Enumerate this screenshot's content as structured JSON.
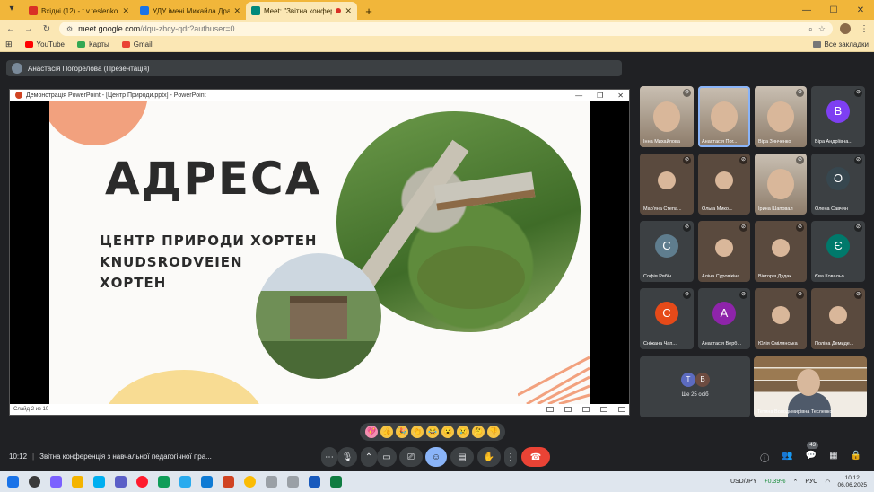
{
  "browser": {
    "tabs": [
      {
        "title": "Вхідні (12) - t.v.teslenko@npu.edu.ua",
        "favicon_color": "#d93025",
        "active": false
      },
      {
        "title": "УДУ імені Михайла Драгоманова",
        "favicon_color": "#1a73e8",
        "active": false
      },
      {
        "title": "Meet: \"Звітна конференція",
        "favicon_color": "#00897b",
        "active": true,
        "recording": true
      }
    ],
    "url_host": "meet.google.com",
    "url_path": "/dqu-zhcy-qdr?authuser=0",
    "bookmarks": [
      {
        "label": "YouTube",
        "color": "#ff0000"
      },
      {
        "label": "Карты",
        "color": "#34a853"
      },
      {
        "label": "Gmail",
        "color": "#ea4335"
      }
    ],
    "all_bookmarks": "Все закладки"
  },
  "meet": {
    "presenter_label": "Анастасія Погорелова (Презентація)",
    "ppt": {
      "window_title": "Демонстрація PowerPoint - [Центр Природи.pptx] - PowerPoint",
      "slide_heading": "АДРЕСА",
      "slide_lines": [
        "ЦЕНТР ПРИРОДИ ХОРТЕН",
        "KNUDSRODVEIEN",
        "ХОРТЕН"
      ],
      "status": "Слайд 2 из 10"
    },
    "participants": [
      {
        "name": "Інна Михайлова",
        "type": "video",
        "mic_muted": true
      },
      {
        "name": "Анастасія Пог...",
        "type": "video",
        "speaking": true
      },
      {
        "name": "Віра Зинченко",
        "type": "video",
        "mic_muted": true
      },
      {
        "name": "Віра Андріївна...",
        "type": "letter",
        "letter": "В",
        "color": "#7e3ff2",
        "mic_muted": true
      },
      {
        "name": "Мар'яна Степа...",
        "type": "photo",
        "mic_muted": true
      },
      {
        "name": "Ольга Мико...",
        "type": "photo",
        "mic_muted": true
      },
      {
        "name": "Ірина Шаповал",
        "type": "video",
        "mic_muted": true
      },
      {
        "name": "Олена Савчин",
        "type": "letter",
        "letter": "О",
        "color": "#37474f",
        "mic_muted": true
      },
      {
        "name": "Софія Рябіч",
        "type": "letter",
        "letter": "С",
        "color": "#5f7d8e",
        "mic_muted": true
      },
      {
        "name": "Аліна Суровікіна",
        "type": "photo",
        "mic_muted": true
      },
      {
        "name": "Вікторія Дудак",
        "type": "photo",
        "mic_muted": true
      },
      {
        "name": "Єва Ковальо...",
        "type": "letter",
        "letter": "Є",
        "color": "#00796b",
        "mic_muted": true
      },
      {
        "name": "Сніжана Чап...",
        "type": "letter",
        "letter": "С",
        "color": "#e64a19",
        "mic_muted": true
      },
      {
        "name": "Анастасія Верб...",
        "type": "letter",
        "letter": "А",
        "color": "#8e24aa",
        "mic_muted": true
      },
      {
        "name": "Юлія Смілянська",
        "type": "photo",
        "mic_muted": true
      },
      {
        "name": "Поліна Демиде...",
        "type": "photo",
        "mic_muted": true
      }
    ],
    "more": {
      "avatars": [
        {
          "letter": "Т",
          "color": "#5c6bc0"
        },
        {
          "letter": "В",
          "color": "#6d4c41"
        }
      ],
      "label": "Ще 25 осіб"
    },
    "self_name": "Тетяна Володимирівна Тесленко",
    "reactions": [
      "💖",
      "👍",
      "🎉",
      "👏",
      "😂",
      "😮",
      "😢",
      "🤔",
      "👎"
    ],
    "time": "10:12",
    "meeting_title": "Звітна конференція з навчальної педагогічної пра...",
    "people_count": "43"
  },
  "taskbar": {
    "icons": [
      {
        "name": "start",
        "color": "#1a73e8"
      },
      {
        "name": "search",
        "color": "#3b3b3b"
      },
      {
        "name": "copilot",
        "color": "#7b61ff"
      },
      {
        "name": "explorer",
        "color": "#f4b400"
      },
      {
        "name": "skype",
        "color": "#00aff0"
      },
      {
        "name": "teams",
        "color": "#5b5fc7"
      },
      {
        "name": "opera",
        "color": "#ff1b2d"
      },
      {
        "name": "app-green",
        "color": "#0f9d58"
      },
      {
        "name": "telegram",
        "color": "#2aabee"
      },
      {
        "name": "edge",
        "color": "#0f7bd4"
      },
      {
        "name": "powerpoint",
        "color": "#d04423"
      },
      {
        "name": "chrome",
        "color": "#fbbc04"
      },
      {
        "name": "app-gray",
        "color": "#9aa0a6"
      },
      {
        "name": "app-gray-2",
        "color": "#9aa0a6"
      },
      {
        "name": "word",
        "color": "#185abd"
      },
      {
        "name": "excel",
        "color": "#107c41"
      }
    ],
    "ticker": "USD/JPY",
    "ticker_change": "+0.39%",
    "lang": "РУС",
    "clock_time": "10:12",
    "clock_date": "06.06.2025"
  }
}
